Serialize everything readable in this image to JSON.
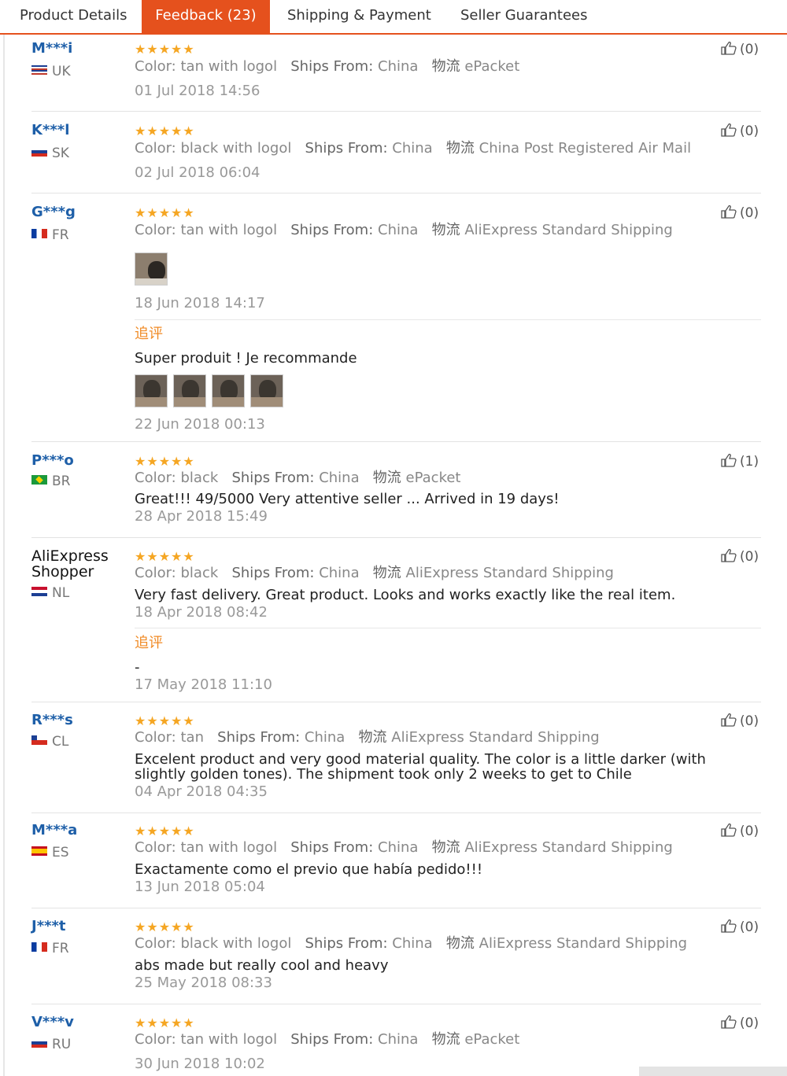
{
  "tabs": [
    {
      "label": "Product Details",
      "active": false
    },
    {
      "label": "Feedback (23)",
      "active": true
    },
    {
      "label": "Shipping & Payment",
      "active": false
    },
    {
      "label": "Seller Guarantees",
      "active": false
    }
  ],
  "labels": {
    "color": "Color:",
    "ships_from": "Ships From:",
    "logistics": "物流",
    "append": "追评"
  },
  "stars_text": "★★★★★",
  "accent_color": "#e5511d",
  "star_color": "#f5a623",
  "reviews": [
    {
      "user": "M***i",
      "country": "UK",
      "rating": 5,
      "color": "tan with logol",
      "ships_from": "China",
      "shipping": "ePacket",
      "text": "",
      "date": "01 Jul 2018 14:56",
      "helpful": "(0)"
    },
    {
      "user": "K***l",
      "country": "SK",
      "rating": 5,
      "color": "black with logol",
      "ships_from": "China",
      "shipping": "China Post Registered Air Mail",
      "text": "",
      "date": "02 Jul 2018 06:04",
      "helpful": "(0)"
    },
    {
      "user": "G***g",
      "country": "FR",
      "rating": 5,
      "color": "tan with logol",
      "ships_from": "China",
      "shipping": "AliExpress Standard Shipping",
      "text": "",
      "date": "18 Jun 2018 14:17",
      "helpful": "(0)",
      "append_text": "Super produit ! Je recommande",
      "append_date": "22 Jun 2018 00:13"
    },
    {
      "user": "P***o",
      "country": "BR",
      "rating": 5,
      "color": "black",
      "ships_from": "China",
      "shipping": "ePacket",
      "text": "Great!!! 49/5000 Very attentive seller ... Arrived in 19 days!",
      "date": "28 Apr 2018 15:49",
      "helpful": "(1)"
    },
    {
      "user": "AliExpress Shopper",
      "country": "NL",
      "rating": 5,
      "color": "black",
      "ships_from": "China",
      "shipping": "AliExpress Standard Shipping",
      "text": "Very fast delivery. Great product. Looks and works exactly like the real item.",
      "date": "18 Apr 2018 08:42",
      "helpful": "(0)",
      "append_text": "-",
      "append_date": "17 May 2018 11:10"
    },
    {
      "user": "R***s",
      "country": "CL",
      "rating": 5,
      "color": "tan",
      "ships_from": "China",
      "shipping": "AliExpress Standard Shipping",
      "text": "Excelent product and very good material quality. The color is a little darker (with slightly golden tones). The shipment took only 2 weeks to get to Chile",
      "date": "04 Apr 2018 04:35",
      "helpful": "(0)"
    },
    {
      "user": "M***a",
      "country": "ES",
      "rating": 5,
      "color": "tan with logol",
      "ships_from": "China",
      "shipping": "AliExpress Standard Shipping",
      "text": "Exactamente como el previo que había pedido!!!",
      "date": "13 Jun 2018 05:04",
      "helpful": "(0)"
    },
    {
      "user": "J***t",
      "country": "FR",
      "rating": 5,
      "color": "black with logol",
      "ships_from": "China",
      "shipping": "AliExpress Standard Shipping",
      "text": "abs made but really cool and heavy",
      "date": "25 May 2018 08:33",
      "helpful": "(0)"
    },
    {
      "user": "V***v",
      "country": "RU",
      "rating": 5,
      "color": "tan with logol",
      "ships_from": "China",
      "shipping": "ePacket",
      "text": "",
      "date": "30 Jun 2018 10:02",
      "helpful": "(0)"
    }
  ]
}
